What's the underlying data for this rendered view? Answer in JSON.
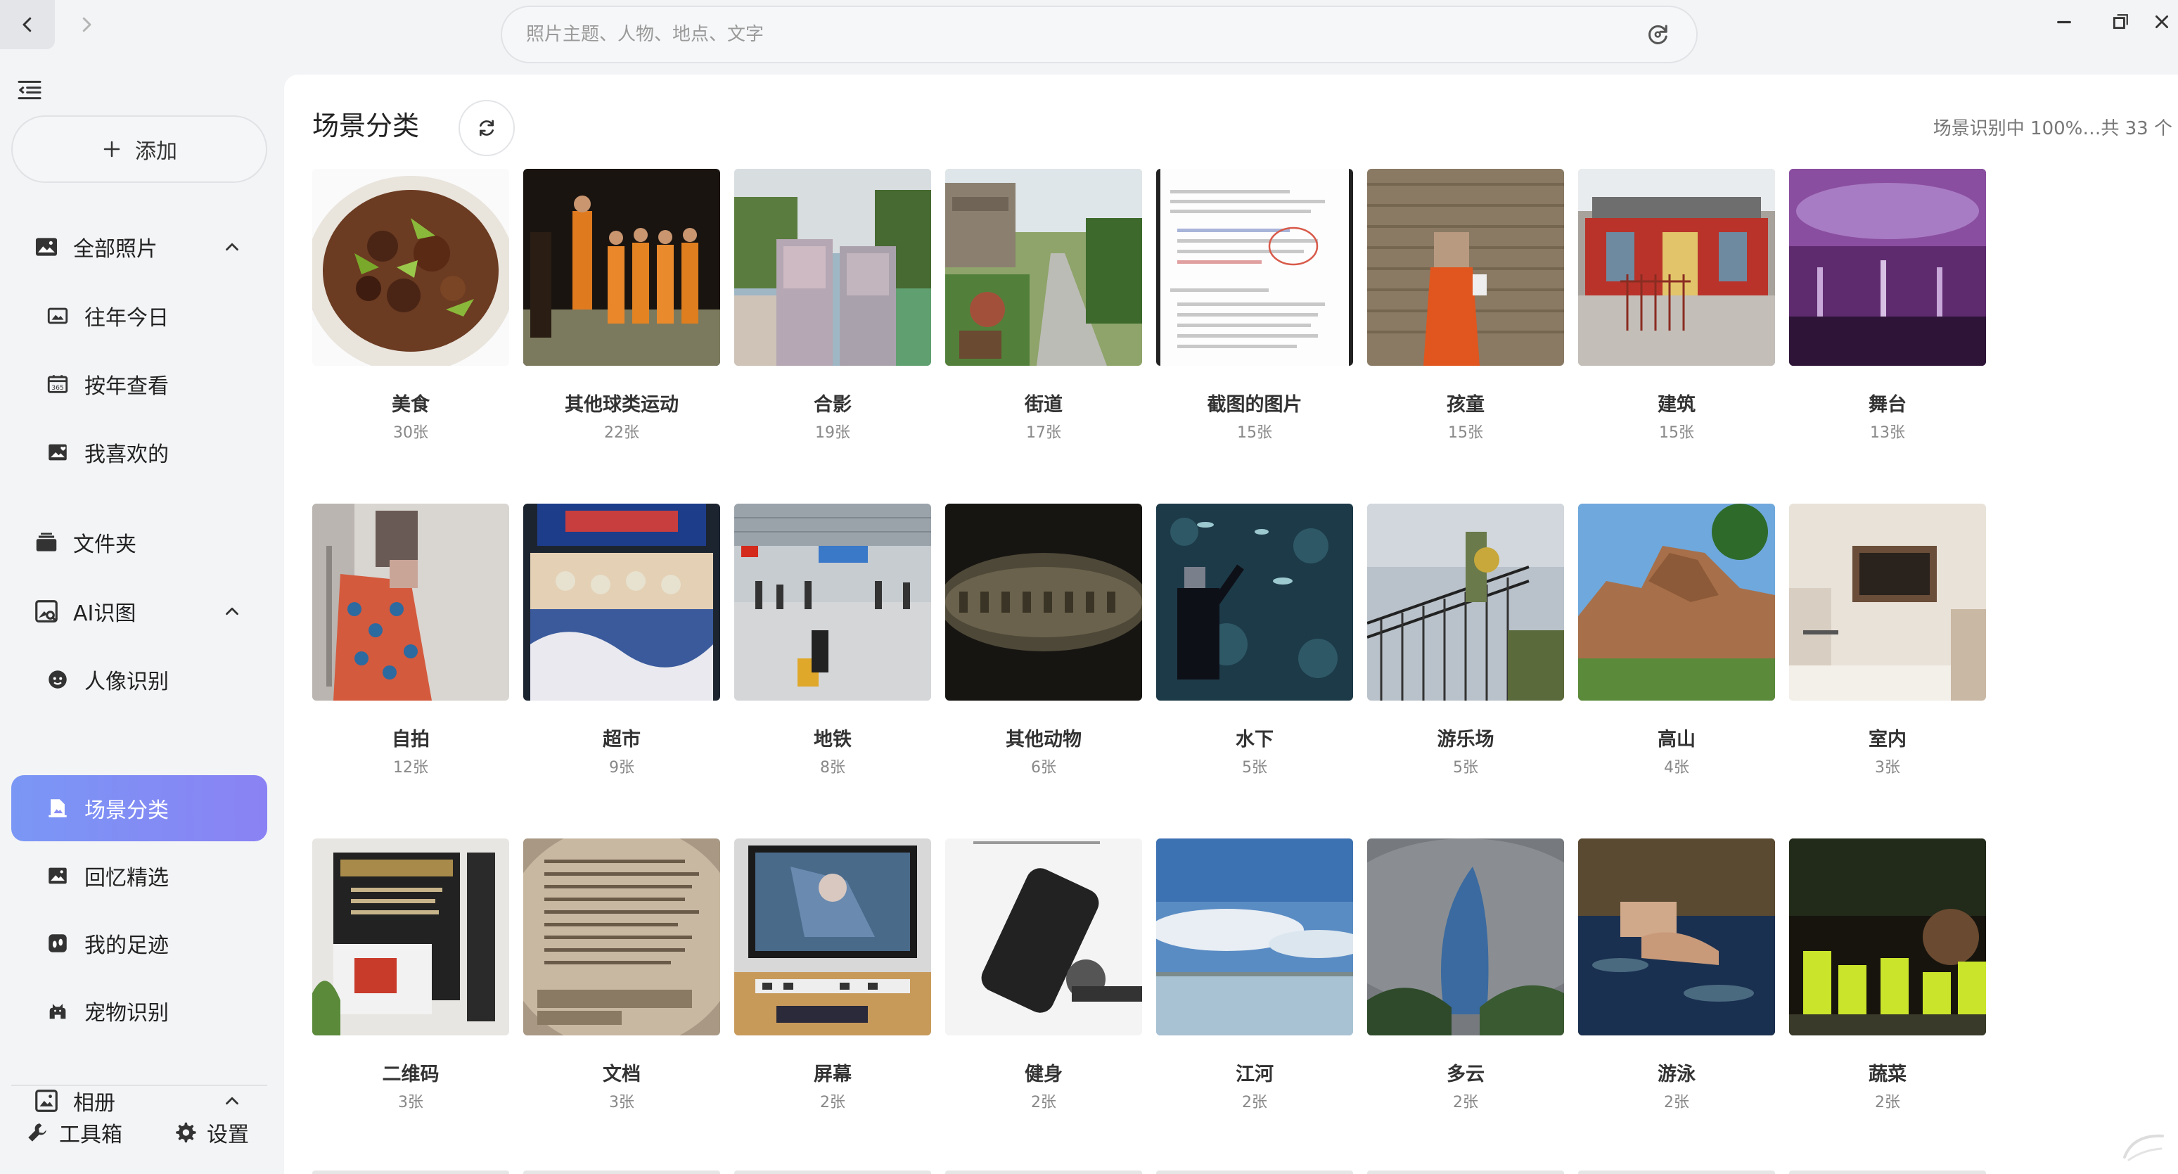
{
  "search": {
    "placeholder": "照片主题、人物、地点、文字"
  },
  "sidebar": {
    "add_label": "添加",
    "sections": [
      {
        "label": "全部照片",
        "icon": "image-icon"
      },
      {
        "label": "文件夹",
        "icon": "folder-icon"
      },
      {
        "label": "AI识图",
        "icon": "ai-image-icon"
      },
      {
        "label": "相册",
        "icon": "album-icon"
      }
    ],
    "items": [
      {
        "label": "往年今日",
        "icon": "calendar-photo-icon"
      },
      {
        "label": "按年查看",
        "icon": "calendar-365-icon"
      },
      {
        "label": "我喜欢的",
        "icon": "heart-photo-icon"
      },
      {
        "label": "人像识别",
        "icon": "face-icon"
      },
      {
        "label": "场景分类",
        "icon": "scene-icon"
      },
      {
        "label": "回忆精选",
        "icon": "memories-icon"
      },
      {
        "label": "我的足迹",
        "icon": "footprint-icon"
      },
      {
        "label": "宠物识别",
        "icon": "pet-icon"
      }
    ],
    "active_item": "场景分类",
    "toolbox_label": "工具箱",
    "settings_label": "设置"
  },
  "main": {
    "title": "场景分类",
    "status": "场景识别中 100%…共 33 个",
    "scenes": [
      {
        "name": "美食",
        "count": "30张",
        "thumb": "food"
      },
      {
        "name": "其他球类运动",
        "count": "22张",
        "thumb": "performance"
      },
      {
        "name": "合影",
        "count": "19张",
        "thumb": "group-photo"
      },
      {
        "name": "街道",
        "count": "17张",
        "thumb": "street"
      },
      {
        "name": "截图的图片",
        "count": "15张",
        "thumb": "screenshot"
      },
      {
        "name": "孩童",
        "count": "15张",
        "thumb": "child"
      },
      {
        "name": "建筑",
        "count": "15张",
        "thumb": "building"
      },
      {
        "name": "舞台",
        "count": "13张",
        "thumb": "stage"
      },
      {
        "name": "自拍",
        "count": "12张",
        "thumb": "selfie"
      },
      {
        "name": "超市",
        "count": "9张",
        "thumb": "market"
      },
      {
        "name": "地铁",
        "count": "8张",
        "thumb": "station"
      },
      {
        "name": "其他动物",
        "count": "6张",
        "thumb": "animal"
      },
      {
        "name": "水下",
        "count": "5张",
        "thumb": "underwater"
      },
      {
        "name": "游乐场",
        "count": "5张",
        "thumb": "playground"
      },
      {
        "name": "高山",
        "count": "4张",
        "thumb": "mountain"
      },
      {
        "name": "室内",
        "count": "3张",
        "thumb": "indoor"
      },
      {
        "name": "二维码",
        "count": "3张",
        "thumb": "qrcode"
      },
      {
        "name": "文档",
        "count": "3张",
        "thumb": "document"
      },
      {
        "name": "屏幕",
        "count": "2张",
        "thumb": "screen"
      },
      {
        "name": "健身",
        "count": "2张",
        "thumb": "fitness"
      },
      {
        "name": "江河",
        "count": "2张",
        "thumb": "river"
      },
      {
        "name": "多云",
        "count": "2张",
        "thumb": "cloudy"
      },
      {
        "name": "游泳",
        "count": "2张",
        "thumb": "swimming"
      },
      {
        "name": "蔬菜",
        "count": "2张",
        "thumb": "vegetable"
      }
    ]
  }
}
